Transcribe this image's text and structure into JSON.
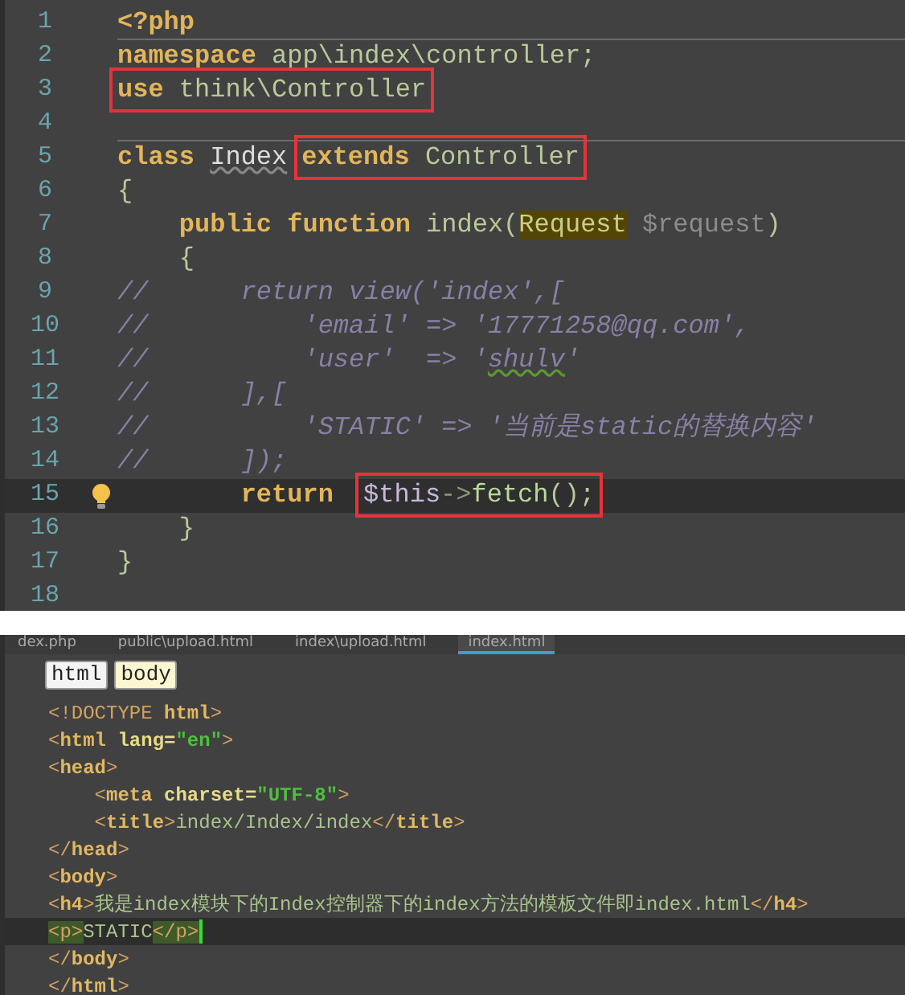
{
  "php_editor": {
    "lines": [
      {
        "number": "1",
        "current": false,
        "bulb": false,
        "rule_below": true,
        "tokens": [
          {
            "kind": "keyword",
            "text": "<?php"
          }
        ]
      },
      {
        "number": "2",
        "current": false,
        "bulb": false,
        "rule_below": false,
        "tokens": [
          {
            "kind": "keyword",
            "text": "namespace"
          },
          {
            "kind": "plain",
            "text": " app\\index\\controller;"
          }
        ]
      },
      {
        "number": "3",
        "current": false,
        "bulb": false,
        "rule_below": false,
        "tokens": [
          {
            "kind": "box",
            "tokens": [
              {
                "kind": "keyword",
                "text": "use"
              },
              {
                "kind": "plain",
                "text": " think\\Controller"
              }
            ]
          }
        ]
      },
      {
        "number": "4",
        "current": false,
        "bulb": false,
        "rule_below": true
      },
      {
        "number": "5",
        "current": false,
        "bulb": false,
        "rule_below": false,
        "tokens": [
          {
            "kind": "keyword",
            "text": "class "
          },
          {
            "kind": "warned-name",
            "text": "Index"
          },
          {
            "kind": "box",
            "tokens": [
              {
                "kind": "keyword",
                "text": "extends"
              },
              {
                "kind": "plain",
                "text": " Controller"
              }
            ]
          }
        ]
      },
      {
        "number": "6",
        "current": false,
        "bulb": false,
        "rule_below": false,
        "tokens": [
          {
            "kind": "plain",
            "text": "{"
          }
        ]
      },
      {
        "number": "7",
        "current": false,
        "bulb": false,
        "rule_below": false,
        "tokens": [
          {
            "kind": "keyword",
            "text": "    public function"
          },
          {
            "kind": "plain",
            "text": " index("
          },
          {
            "kind": "type-marked",
            "text": "Request"
          },
          {
            "kind": "variable",
            "text": " $request"
          },
          {
            "kind": "plain",
            "text": ")"
          }
        ]
      },
      {
        "number": "8",
        "current": false,
        "bulb": false,
        "rule_below": false,
        "tokens": [
          {
            "kind": "plain",
            "text": "    {"
          }
        ]
      },
      {
        "number": "9",
        "current": false,
        "bulb": false,
        "rule_below": false,
        "tokens": [
          {
            "kind": "comment",
            "text": "//      return view('index',["
          }
        ]
      },
      {
        "number": "10",
        "current": false,
        "bulb": false,
        "rule_below": false,
        "tokens": [
          {
            "kind": "comment",
            "text": "//          'email' => '17771258@qq.com',"
          }
        ]
      },
      {
        "number": "11",
        "current": false,
        "bulb": false,
        "rule_below": false,
        "tokens": [
          {
            "kind": "comment",
            "text": "//          'user'  => '"
          },
          {
            "kind": "warned-comment",
            "text": "shulv"
          },
          {
            "kind": "comment",
            "text": "'"
          }
        ]
      },
      {
        "number": "12",
        "current": false,
        "bulb": false,
        "rule_below": false,
        "tokens": [
          {
            "kind": "comment",
            "text": "//      ],["
          }
        ]
      },
      {
        "number": "13",
        "current": false,
        "bulb": false,
        "rule_below": false,
        "tokens": [
          {
            "kind": "comment",
            "text": "//          'STATIC' => '当前是static的替换内容'"
          }
        ]
      },
      {
        "number": "14",
        "current": false,
        "bulb": false,
        "rule_below": false,
        "tokens": [
          {
            "kind": "comment",
            "text": "//      ]);"
          }
        ]
      },
      {
        "number": "15",
        "current": true,
        "bulb": true,
        "rule_below": false,
        "tokens": [
          {
            "kind": "keyword",
            "text": "        return "
          },
          {
            "kind": "box",
            "tokens": [
              {
                "kind": "this",
                "text": "$this"
              },
              {
                "kind": "arrow",
                "text": "->"
              },
              {
                "kind": "call",
                "text": "fetch"
              },
              {
                "kind": "plain",
                "text": "();"
              }
            ]
          }
        ]
      },
      {
        "number": "16",
        "current": false,
        "bulb": false,
        "rule_below": false,
        "tokens": [
          {
            "kind": "plain",
            "text": "    }"
          }
        ]
      },
      {
        "number": "17",
        "current": false,
        "bulb": false,
        "rule_below": false,
        "tokens": [
          {
            "kind": "plain",
            "text": "}"
          }
        ]
      },
      {
        "number": "18",
        "current": false,
        "bulb": false,
        "rule_below": false
      }
    ]
  },
  "html_editor": {
    "tabs": [
      {
        "label": "dex.php",
        "selected": false
      },
      {
        "label": "public\\upload.html",
        "selected": false
      },
      {
        "label": "index\\upload.html",
        "selected": false
      },
      {
        "label": "index.html",
        "selected": true
      }
    ],
    "breadcrumbs": [
      {
        "label": "html",
        "selected": false
      },
      {
        "label": "body",
        "selected": true
      }
    ],
    "lines": [
      {
        "current": false,
        "tokens": [
          {
            "kind": "bracket",
            "text": "<!DOCTYPE "
          },
          {
            "kind": "tag",
            "text": "html"
          },
          {
            "kind": "bracket",
            "text": ">"
          }
        ]
      },
      {
        "current": false,
        "tokens": [
          {
            "kind": "bracket",
            "text": "<"
          },
          {
            "kind": "tag",
            "text": "html "
          },
          {
            "kind": "attr",
            "text": "lang="
          },
          {
            "kind": "value",
            "text": "\"en\""
          },
          {
            "kind": "bracket",
            "text": ">"
          }
        ]
      },
      {
        "current": false,
        "tokens": [
          {
            "kind": "bracket",
            "text": "<"
          },
          {
            "kind": "tag",
            "text": "head"
          },
          {
            "kind": "bracket",
            "text": ">"
          }
        ]
      },
      {
        "current": false,
        "tokens": [
          {
            "kind": "bracket",
            "text": "    <"
          },
          {
            "kind": "tag",
            "text": "meta "
          },
          {
            "kind": "attr",
            "text": "charset="
          },
          {
            "kind": "value",
            "text": "\"UTF-8\""
          },
          {
            "kind": "bracket",
            "text": ">"
          }
        ]
      },
      {
        "current": false,
        "tokens": [
          {
            "kind": "bracket",
            "text": "    <"
          },
          {
            "kind": "tag",
            "text": "title"
          },
          {
            "kind": "bracket",
            "text": ">"
          },
          {
            "kind": "text",
            "text": "index/Index/index"
          },
          {
            "kind": "bracket",
            "text": "</"
          },
          {
            "kind": "tag",
            "text": "title"
          },
          {
            "kind": "bracket",
            "text": ">"
          }
        ]
      },
      {
        "current": false,
        "tokens": [
          {
            "kind": "bracket",
            "text": "</"
          },
          {
            "kind": "tag",
            "text": "head"
          },
          {
            "kind": "bracket",
            "text": ">"
          }
        ]
      },
      {
        "current": false,
        "tokens": [
          {
            "kind": "bracket",
            "text": "<"
          },
          {
            "kind": "tag",
            "text": "body"
          },
          {
            "kind": "bracket",
            "text": ">"
          }
        ]
      },
      {
        "current": false,
        "tokens": [
          {
            "kind": "bracket",
            "text": "<"
          },
          {
            "kind": "tag",
            "text": "h4"
          },
          {
            "kind": "bracket",
            "text": ">"
          },
          {
            "kind": "text",
            "text": "我是index模块下的Index控制器下的index方法的模板文件即index.html"
          },
          {
            "kind": "bracket",
            "text": "</"
          },
          {
            "kind": "tag",
            "text": "h4"
          },
          {
            "kind": "bracket",
            "text": ">"
          }
        ]
      },
      {
        "current": true,
        "tokens": [
          {
            "kind": "matched-tag",
            "text": "<p>"
          },
          {
            "kind": "text",
            "text": "STATIC"
          },
          {
            "kind": "matched-tag",
            "text": "</p>"
          }
        ]
      },
      {
        "current": false,
        "tokens": [
          {
            "kind": "bracket",
            "text": "</"
          },
          {
            "kind": "tag",
            "text": "body"
          },
          {
            "kind": "bracket",
            "text": ">"
          }
        ]
      },
      {
        "current": false,
        "tokens": [
          {
            "kind": "bracket",
            "text": "</"
          },
          {
            "kind": "tag",
            "text": "html"
          },
          {
            "kind": "bracket",
            "text": ">"
          }
        ]
      }
    ]
  }
}
